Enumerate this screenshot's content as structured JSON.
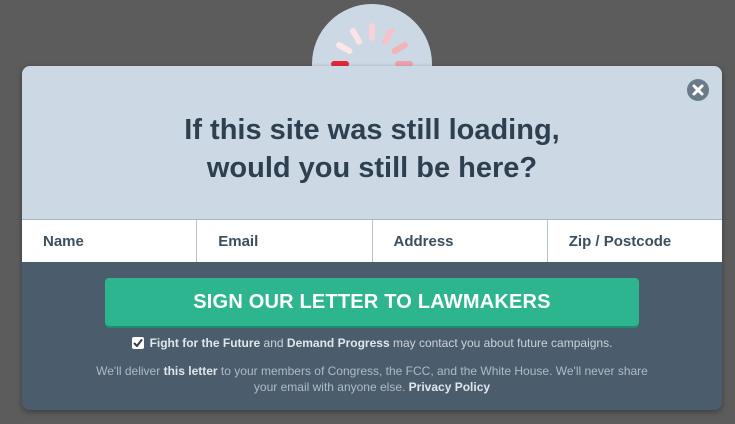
{
  "headline": {
    "line1": "If this site was still loading,",
    "line2": "would you still be here?"
  },
  "form": {
    "fields": [
      {
        "placeholder": "Name"
      },
      {
        "placeholder": "Email"
      },
      {
        "placeholder": "Address"
      },
      {
        "placeholder": "Zip / Postcode"
      }
    ],
    "submit_label": "SIGN OUR LETTER TO LAWMAKERS"
  },
  "consent": {
    "checked": true,
    "org1": "Fight for the Future",
    "and_text": " and ",
    "org2": "Demand Progress",
    "rest": " may contact you about future campaigns."
  },
  "disclaimer": {
    "part1": "We'll deliver ",
    "letter_link": "this letter",
    "part2": " to your members of Congress, the FCC, and the White House. We'll never share your email with anyone else. ",
    "privacy_link": "Privacy Policy"
  },
  "icons": {
    "spinner": "loading-spinner-icon",
    "close": "close-icon",
    "check": "checkmark-icon"
  },
  "colors": {
    "accent": "#2cb58e",
    "spinner": "#e8253a",
    "header_bg": "#ccd9e4",
    "footer_bg": "#4b5d6d"
  }
}
